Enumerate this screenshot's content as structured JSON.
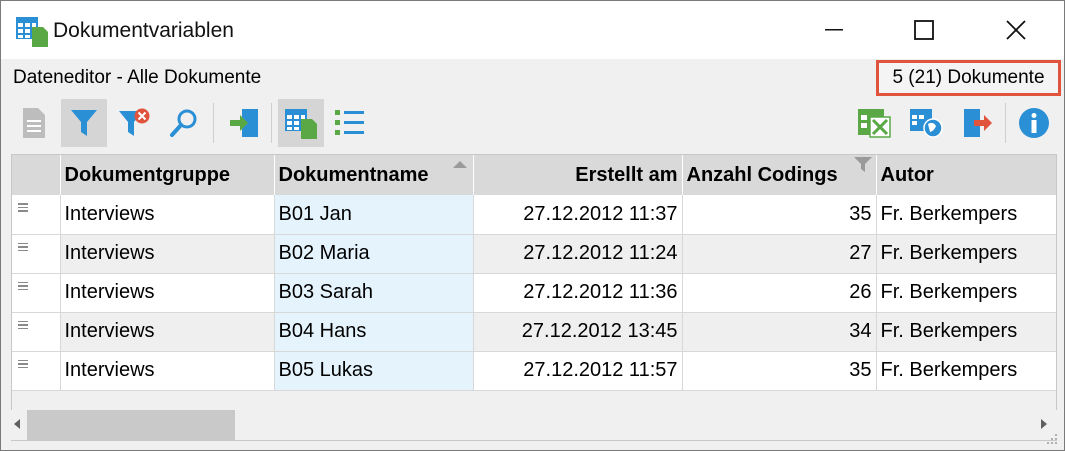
{
  "window": {
    "title": "Dokumentvariablen"
  },
  "info_bar": {
    "left_text": "Dateneditor - Alle Dokumente",
    "doc_count": "5 (21) Dokumente",
    "highlight_color": "#e0533d"
  },
  "toolbar": {
    "left": [
      {
        "icon": "document-icon",
        "active": false
      },
      {
        "icon": "filter-icon",
        "active": true
      },
      {
        "icon": "filter-remove-icon",
        "active": false
      },
      {
        "icon": "search-icon",
        "active": false
      },
      {
        "icon": "import-icon",
        "active": false
      },
      {
        "icon": "table-view-icon",
        "active": true
      },
      {
        "icon": "list-view-icon",
        "active": false
      }
    ],
    "right": [
      {
        "icon": "excel-export-icon"
      },
      {
        "icon": "web-export-icon"
      },
      {
        "icon": "export-icon"
      },
      {
        "icon": "info-icon"
      }
    ]
  },
  "grid": {
    "columns": [
      "",
      "Dokumentgruppe",
      "Dokumentname",
      "Erstellt am",
      "Anzahl Codings",
      "Autor"
    ],
    "sorted_column": "Dokumentname",
    "filtered_column": "Anzahl Codings",
    "rows": [
      {
        "gruppe": "Interviews",
        "name": "B01 Jan",
        "erstellt": "27.12.2012 11:37",
        "codings": "35",
        "autor": "Fr. Berkempers"
      },
      {
        "gruppe": "Interviews",
        "name": "B02 Maria",
        "erstellt": "27.12.2012 11:24",
        "codings": "27",
        "autor": "Fr. Berkempers"
      },
      {
        "gruppe": "Interviews",
        "name": "B03 Sarah",
        "erstellt": "27.12.2012 11:36",
        "codings": "26",
        "autor": "Fr. Berkempers"
      },
      {
        "gruppe": "Interviews",
        "name": "B04 Hans",
        "erstellt": "27.12.2012 13:45",
        "codings": "34",
        "autor": "Fr. Berkempers"
      },
      {
        "gruppe": "Interviews",
        "name": "B05 Lukas",
        "erstellt": "27.12.2012 11:57",
        "codings": "35",
        "autor": "Fr. Berkempers"
      }
    ]
  },
  "colors": {
    "accent_blue": "#2b8fd6",
    "accent_green": "#59a845",
    "accent_red": "#e0533d"
  }
}
